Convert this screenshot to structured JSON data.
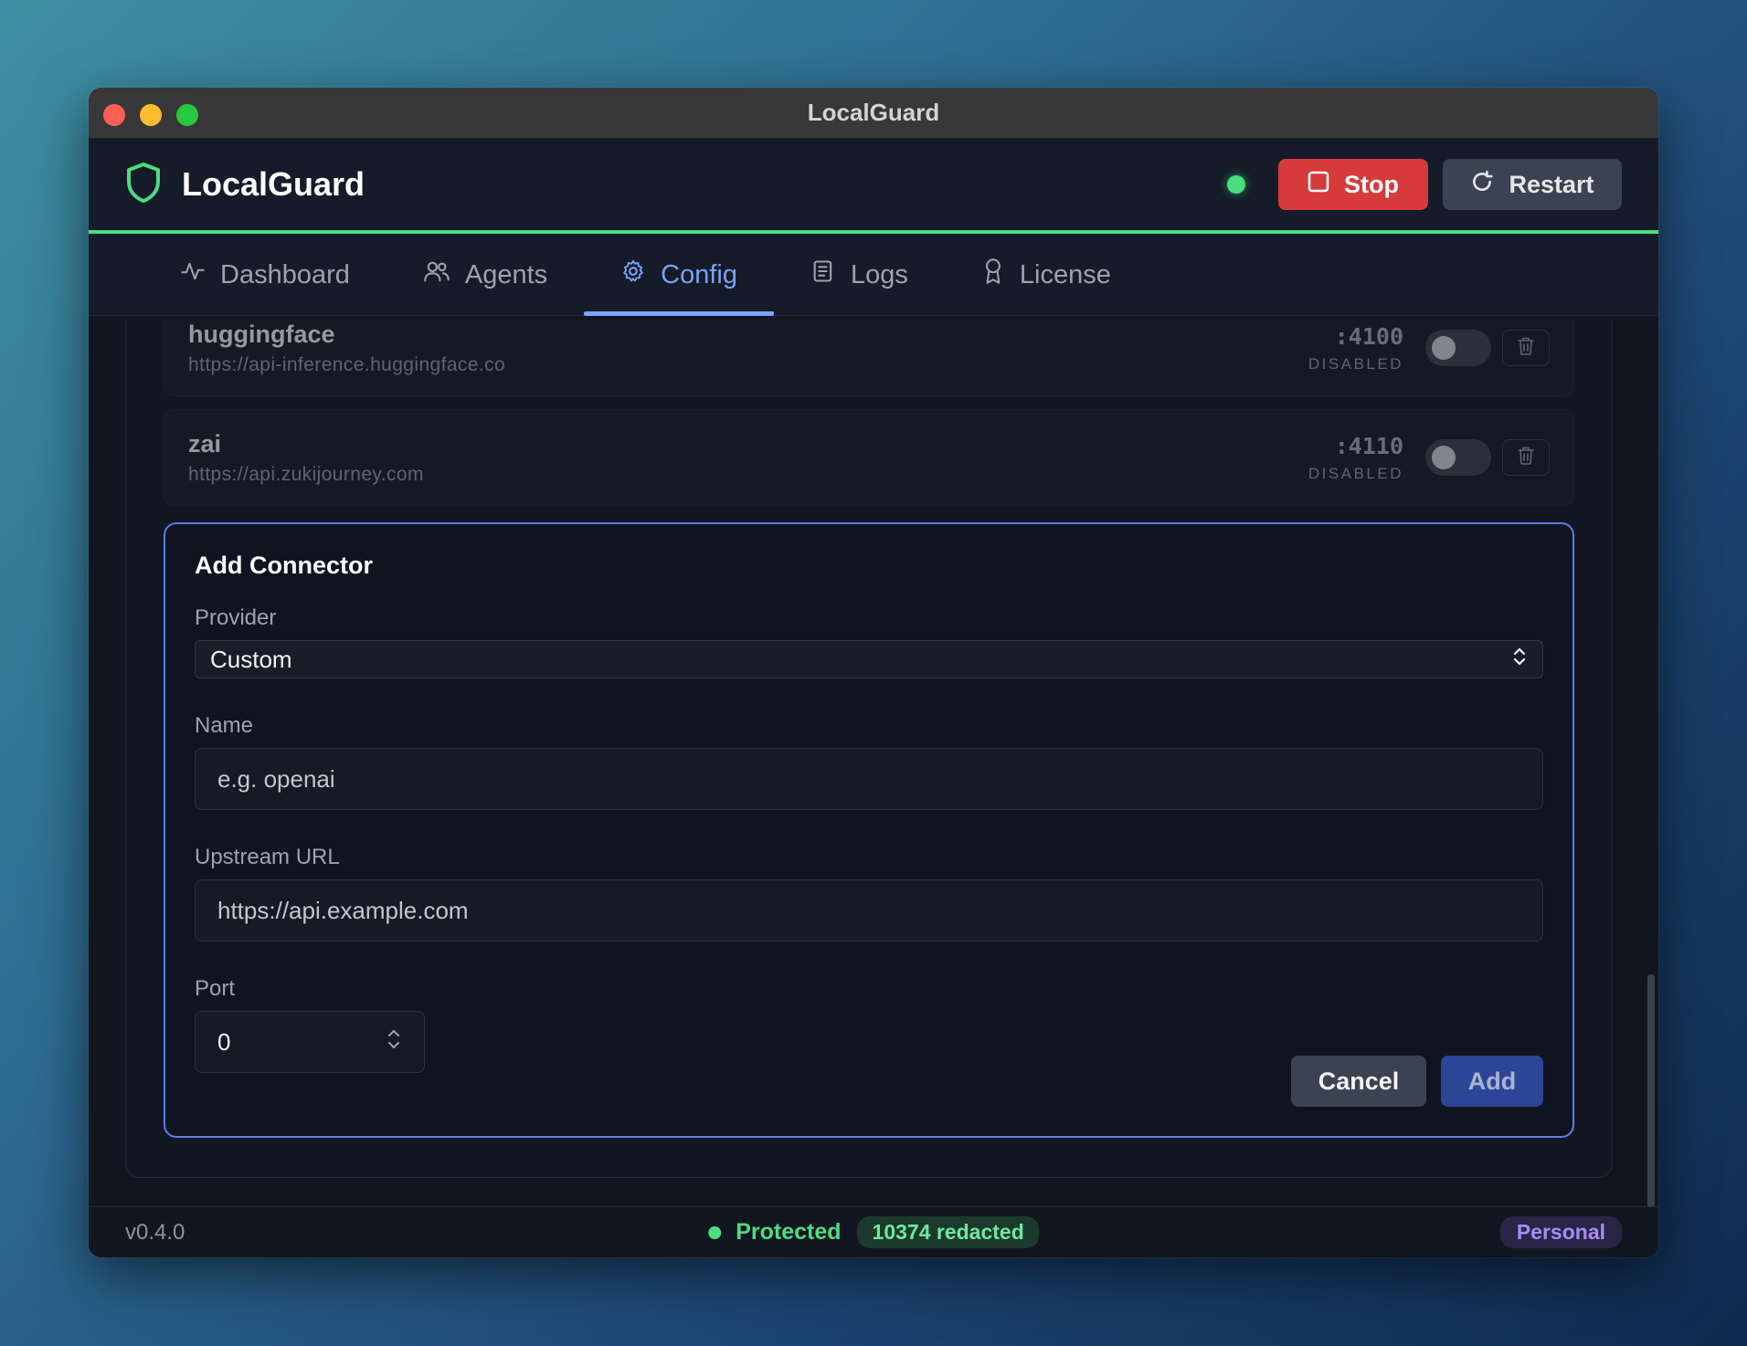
{
  "window": {
    "title": "LocalGuard"
  },
  "header": {
    "app_name": "LocalGuard",
    "stop_label": "Stop",
    "restart_label": "Restart"
  },
  "tabs": [
    {
      "label": "Dashboard",
      "icon": "activity-icon",
      "active": false
    },
    {
      "label": "Agents",
      "icon": "users-icon",
      "active": false
    },
    {
      "label": "Config",
      "icon": "gear-icon",
      "active": true
    },
    {
      "label": "Logs",
      "icon": "scroll-icon",
      "active": false
    },
    {
      "label": "License",
      "icon": "award-icon",
      "active": false
    }
  ],
  "connectors": [
    {
      "name": "huggingface",
      "url": "https://api-inference.huggingface.co",
      "port": ":4100",
      "status": "DISABLED",
      "enabled": false
    },
    {
      "name": "zai",
      "url": "https://api.zukijourney.com",
      "port": ":4110",
      "status": "DISABLED",
      "enabled": false
    }
  ],
  "add_connector": {
    "title": "Add Connector",
    "provider_label": "Provider",
    "provider_value": "Custom",
    "name_label": "Name",
    "name_placeholder": "e.g. openai",
    "url_label": "Upstream URL",
    "url_placeholder": "https://api.example.com",
    "port_label": "Port",
    "port_value": "0",
    "cancel_label": "Cancel",
    "add_label": "Add"
  },
  "footer": {
    "version": "v0.4.0",
    "status": "Protected",
    "redacted": "10374 redacted",
    "plan": "Personal"
  },
  "colors": {
    "accent": "#7aa2f7",
    "success": "#4ade80",
    "danger": "#d63a3a",
    "plan": "#a78bfa"
  }
}
